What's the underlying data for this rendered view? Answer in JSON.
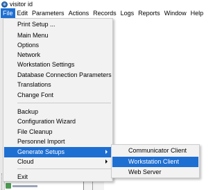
{
  "window": {
    "title": "visitor id",
    "icon": "app-logo-icon"
  },
  "menubar": {
    "items": [
      "File",
      "Edit",
      "Parameters",
      "Actions",
      "Records",
      "Logs",
      "Reports",
      "Window",
      "Help"
    ],
    "active": "File",
    "active_color": "#1e6fd2"
  },
  "file_menu": {
    "items": [
      "Print Setup ...",
      "Main Menu",
      "Options",
      "Network",
      "Workstation Settings",
      "Database Connection Parameters",
      "Translations",
      "Change Font",
      "Backup",
      "Configuration Wizard",
      "File Cleanup",
      "Personnel Import",
      "Generate Setups",
      "Cloud",
      "Exit"
    ],
    "highlighted": "Generate Setups"
  },
  "submenu": {
    "items": [
      "Communicator Client",
      "Workstation Client",
      "Web Server"
    ],
    "highlighted": "Workstation Client"
  }
}
